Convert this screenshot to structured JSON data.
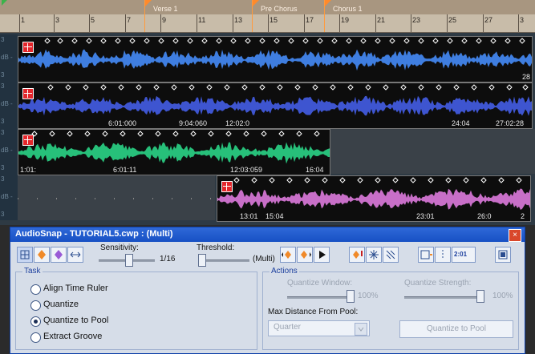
{
  "ruler": {
    "numbers": [
      "1",
      "3",
      "5",
      "7",
      "9",
      "11",
      "13",
      "15",
      "17",
      "19",
      "21",
      "23",
      "25",
      "27",
      "3"
    ],
    "markers": [
      {
        "label": "Verse 1"
      },
      {
        "label": "Pre Chorus"
      },
      {
        "label": "Chorus 1"
      }
    ]
  },
  "tracks": [
    {
      "lane_labels": [
        "3",
        "dB -",
        "3"
      ],
      "color": "#3f7ee0",
      "timestamps": [
        "28"
      ]
    },
    {
      "lane_labels": [
        "3",
        "dB -",
        "3"
      ],
      "color": "#3e55d0",
      "timestamps": [
        "6:01:000",
        "9:04:060",
        "12:02:0",
        "24:04",
        "27:02:28"
      ]
    },
    {
      "lane_labels": [
        "3",
        "dB -",
        "3"
      ],
      "color": "#27c07a",
      "timestamps": [
        "1:01:",
        "6:01:11",
        "12:03:059",
        "16:04"
      ]
    },
    {
      "lane_labels": [
        "3",
        "dB -",
        "3"
      ],
      "color": "#c86fc8",
      "timestamps": [
        "13:01",
        "15:04",
        "23:01",
        "26:0",
        "2"
      ]
    }
  ],
  "panel": {
    "title": "AudioSnap - TUTORIAL5.cwp : (Multi)",
    "close": "×",
    "sensitivity_label": "Sensitivity:",
    "sensitivity_value": "1/16",
    "threshold_label": "Threshold:",
    "threshold_suffix": "(Multi)",
    "task_title": "Task",
    "task_options": [
      "Align Time Ruler",
      "Quantize",
      "Quantize to Pool",
      "Extract Groove"
    ],
    "task_selected": 2,
    "actions_title": "Actions",
    "quantize_window_label": "Quantize Window:",
    "quantize_window_value": "100%",
    "quantize_strength_label": "Quantize Strength:",
    "quantize_strength_value": "100%",
    "max_distance_label": "Max Distance From Pool:",
    "max_distance_value": "Quarter",
    "quantize_to_pool_button": "Quantize to Pool",
    "zoom_badge": "2:01"
  }
}
